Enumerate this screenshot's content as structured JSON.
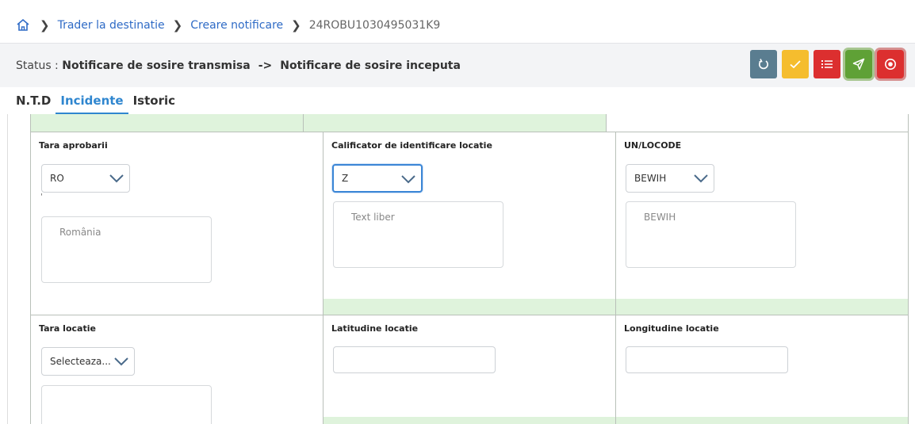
{
  "breadcrumb": {
    "home_icon": "home-icon",
    "items": [
      "Trader la destinatie",
      "Creare notificare"
    ],
    "current": "24ROBU1030495031K9"
  },
  "status": {
    "label": "Status :",
    "from": "Notificare de sosire transmisa",
    "arrow": "->",
    "to": "Notificare de sosire inceputa"
  },
  "actions": [
    {
      "icon": "undo-icon",
      "color": "#5a7d90"
    },
    {
      "icon": "check-icon",
      "color": "#f5bd2e"
    },
    {
      "icon": "list-icon",
      "color": "#dc2f2f"
    },
    {
      "icon": "send-icon",
      "color": "#5fa136"
    },
    {
      "icon": "stop-icon",
      "color": "#dc2f2f"
    }
  ],
  "tabs": [
    {
      "label": "N.T.D",
      "active": false
    },
    {
      "label": "Incidente",
      "active": true
    },
    {
      "label": "Istoric",
      "active": false
    }
  ],
  "form": {
    "tara_aprobarii": {
      "title": "Tara aprobarii",
      "value": "RO",
      "text": "România",
      "mark": "'"
    },
    "calificator": {
      "title": "Calificator de identificare locatie",
      "value": "Z",
      "text": "Text liber"
    },
    "unlocode": {
      "title": "UN/LOCODE",
      "value": "BEWIH",
      "text": "BEWIH"
    },
    "tara_locatie": {
      "title": "Tara locatie",
      "value": "Selecteaza...",
      "text": ""
    },
    "latitudine": {
      "title": "Latitudine locatie",
      "value": ""
    },
    "longitudine": {
      "title": "Longitudine locatie",
      "value": ""
    }
  },
  "colors": {
    "link": "#2f6bc6",
    "active_tab": "#2f86cf",
    "green_band": "#dff3dc"
  }
}
